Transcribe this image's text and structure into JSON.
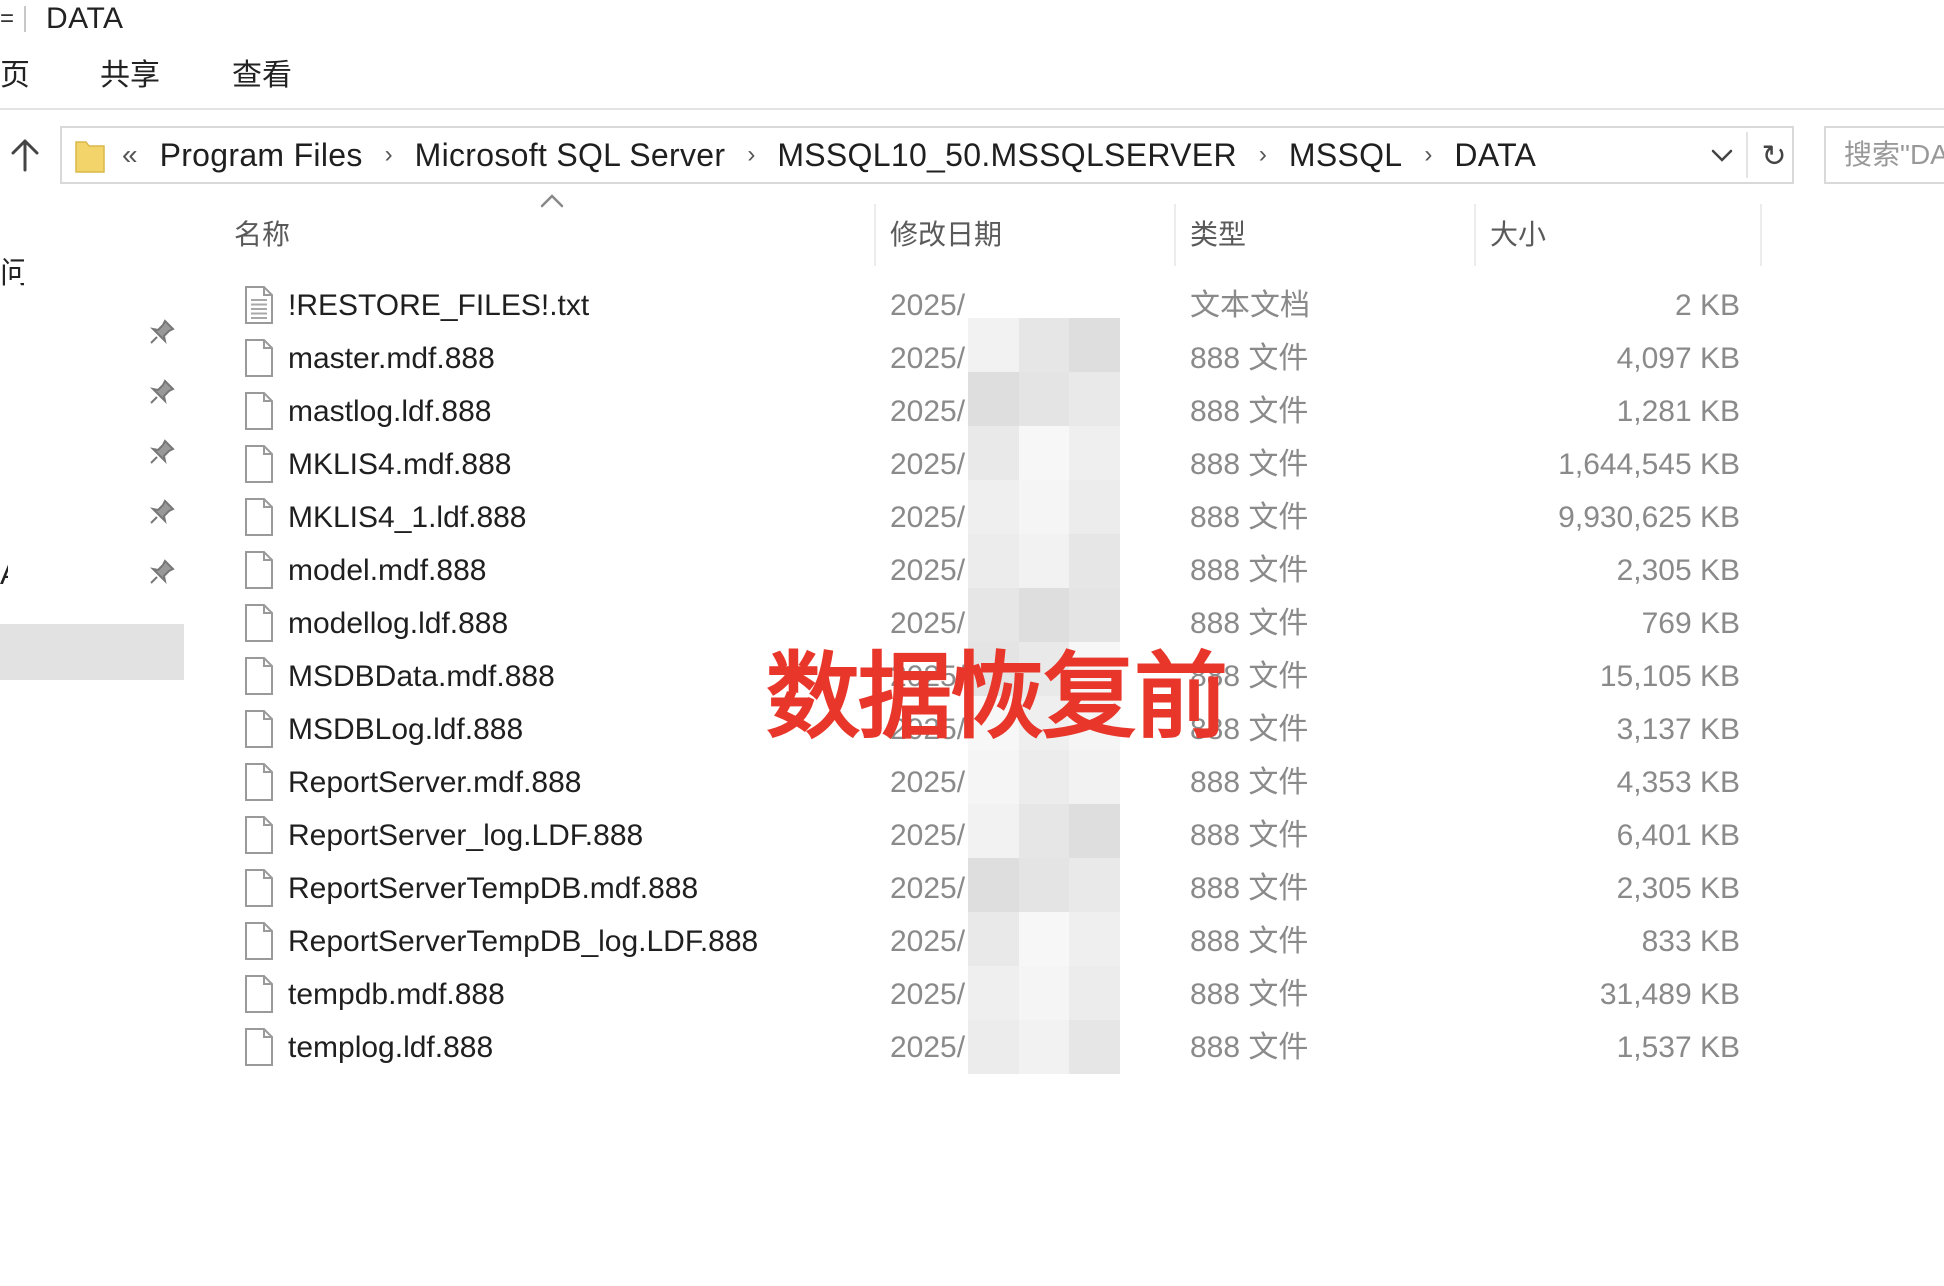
{
  "window": {
    "title": "DATA",
    "menu_glyph": "="
  },
  "ribbon": {
    "tabs": [
      {
        "label": "页"
      },
      {
        "label": "共享"
      },
      {
        "label": "查看"
      }
    ]
  },
  "address": {
    "overflow": "«",
    "crumbs": [
      "Program Files",
      "Microsoft SQL Server",
      "MSSQL10_50.MSSQLSERVER",
      "MSSQL",
      "DATA"
    ],
    "chevron": "›",
    "refresh_glyph": "↻"
  },
  "search": {
    "placeholder": "搜索\"DATA\""
  },
  "navpane": {
    "quick_access_label": "问",
    "fragment_label": "A"
  },
  "columns": {
    "name": "名称",
    "date": "修改日期",
    "type": "类型",
    "size": "大小"
  },
  "files": [
    {
      "name": "!RESTORE_FILES!.txt",
      "date": "2025/",
      "type": "文本文档",
      "size": "2 KB",
      "icon": "text-file-icon"
    },
    {
      "name": "master.mdf.888",
      "date": "2025/",
      "type": "888 文件",
      "size": "4,097 KB",
      "icon": "file-icon"
    },
    {
      "name": "mastlog.ldf.888",
      "date": "2025/",
      "type": "888 文件",
      "size": "1,281 KB",
      "icon": "file-icon"
    },
    {
      "name": "MKLIS4.mdf.888",
      "date": "2025/",
      "type": "888 文件",
      "size": "1,644,545 KB",
      "icon": "file-icon"
    },
    {
      "name": "MKLIS4_1.ldf.888",
      "date": "2025/",
      "type": "888 文件",
      "size": "9,930,625 KB",
      "icon": "file-icon"
    },
    {
      "name": "model.mdf.888",
      "date": "2025/",
      "type": "888 文件",
      "size": "2,305 KB",
      "icon": "file-icon"
    },
    {
      "name": "modellog.ldf.888",
      "date": "2025/",
      "type": "888 文件",
      "size": "769 KB",
      "icon": "file-icon"
    },
    {
      "name": "MSDBData.mdf.888",
      "date": "2025/",
      "type": "888 文件",
      "size": "15,105 KB",
      "icon": "file-icon"
    },
    {
      "name": "MSDBLog.ldf.888",
      "date": "2025/",
      "type": "888 文件",
      "size": "3,137 KB",
      "icon": "file-icon"
    },
    {
      "name": "ReportServer.mdf.888",
      "date": "2025/",
      "type": "888 文件",
      "size": "4,353 KB",
      "icon": "file-icon"
    },
    {
      "name": "ReportServer_log.LDF.888",
      "date": "2025/",
      "type": "888 文件",
      "size": "6,401 KB",
      "icon": "file-icon"
    },
    {
      "name": "ReportServerTempDB.mdf.888",
      "date": "2025/",
      "type": "888 文件",
      "size": "2,305 KB",
      "icon": "file-icon"
    },
    {
      "name": "ReportServerTempDB_log.LDF.888",
      "date": "2025/",
      "type": "888 文件",
      "size": "833 KB",
      "icon": "file-icon"
    },
    {
      "name": "tempdb.mdf.888",
      "date": "2025/",
      "type": "888 文件",
      "size": "31,489 KB",
      "icon": "file-icon"
    },
    {
      "name": "templog.ldf.888",
      "date": "2025/",
      "type": "888 文件",
      "size": "1,537 KB",
      "icon": "file-icon"
    }
  ],
  "overlay": {
    "caption": "数据恢复前",
    "color": "#e8362a"
  },
  "colors": {
    "folder": "#f3d46a",
    "selected_nav": "#e2e2e2",
    "muted_text": "#8a8a8a"
  }
}
